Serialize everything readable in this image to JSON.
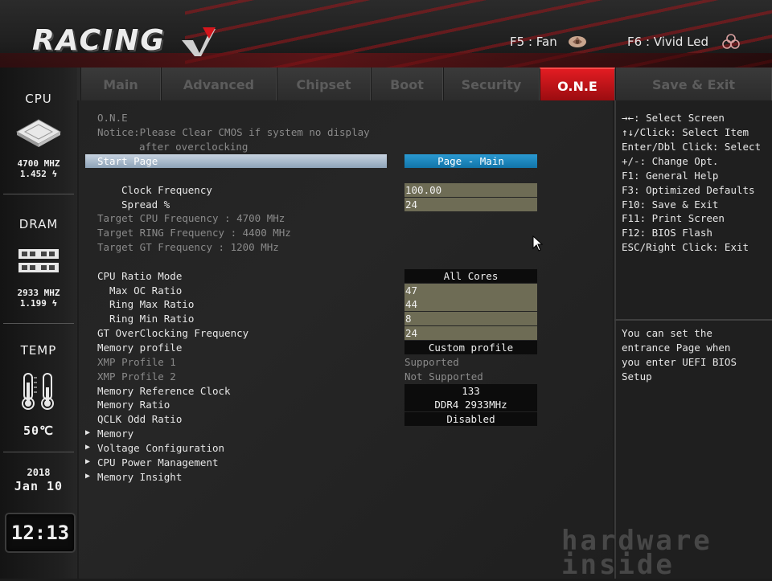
{
  "header": {
    "brand": "RACING",
    "hotkey_fan": "F5 : Fan",
    "hotkey_led": "F6 : Vivid Led",
    "accent": "#d4161c"
  },
  "sidebar": {
    "cpu": {
      "title": "CPU",
      "freq": "4700 MHZ",
      "volt": "1.452 ϟ"
    },
    "dram": {
      "title": "DRAM",
      "freq": "2933 MHZ",
      "volt": "1.199 ϟ"
    },
    "temp": {
      "title": "TEMP",
      "value": "50℃"
    },
    "date": {
      "year": "2018",
      "day": "Jan 10"
    },
    "clock": "12:13"
  },
  "tabs": [
    {
      "label": "Main"
    },
    {
      "label": "Advanced"
    },
    {
      "label": "Chipset"
    },
    {
      "label": "Boot"
    },
    {
      "label": "Security"
    },
    {
      "label": "O.N.E"
    },
    {
      "label": "Save & Exit"
    }
  ],
  "main": {
    "section_title": "O.N.E",
    "notice_1": "Notice:Please Clear CMOS if system no display",
    "notice_2": "after overclocking",
    "start_page": {
      "label": "Start Page",
      "value": "Page - Main"
    },
    "clock_frequency": {
      "label": "Clock Frequency",
      "value": "100.00"
    },
    "spread": {
      "label": "Spread %",
      "value": "24"
    },
    "target_cpu": "Target CPU Frequency : 4700 MHz",
    "target_ring": "Target RING Frequency : 4400 MHz",
    "target_gt": "Target GT Frequency : 1200 MHz",
    "cpu_ratio_mode": {
      "label": "CPU Ratio Mode",
      "value": "All Cores"
    },
    "max_oc_ratio": {
      "label": "Max OC Ratio",
      "value": "47"
    },
    "ring_max_ratio": {
      "label": "Ring Max Ratio",
      "value": "44"
    },
    "ring_min_ratio": {
      "label": "Ring Min Ratio",
      "value": "8"
    },
    "gt_oc_freq": {
      "label": "GT OverClocking Frequency",
      "value": "24"
    },
    "memory_profile": {
      "label": "Memory profile",
      "value": "Custom profile"
    },
    "xmp1": {
      "label": "XMP Profile 1",
      "value": "Supported"
    },
    "xmp2": {
      "label": "XMP Profile 2",
      "value": "Not Supported"
    },
    "mem_ref_clock": {
      "label": "Memory Reference Clock",
      "value": "133"
    },
    "mem_ratio": {
      "label": "Memory Ratio",
      "value": "DDR4 2933MHz"
    },
    "qclk": {
      "label": "QCLK Odd Ratio",
      "value": "Disabled"
    },
    "submenus": [
      "Memory",
      "Voltage Configuration",
      "CPU Power Management",
      "Memory Insight"
    ]
  },
  "help": {
    "keys": [
      "→←: Select Screen",
      "↑↓/Click: Select Item",
      "Enter/Dbl Click: Select",
      "+/-: Change Opt.",
      "F1: General Help",
      "F3: Optimized Defaults",
      "F10: Save & Exit",
      "F11: Print Screen",
      "F12: BIOS Flash",
      "ESC/Right Click: Exit"
    ],
    "description": [
      "You can set the",
      "entrance Page when",
      "you enter UEFI BIOS",
      "Setup"
    ]
  },
  "watermark": {
    "line1": "hardware",
    "line2": "inside"
  }
}
